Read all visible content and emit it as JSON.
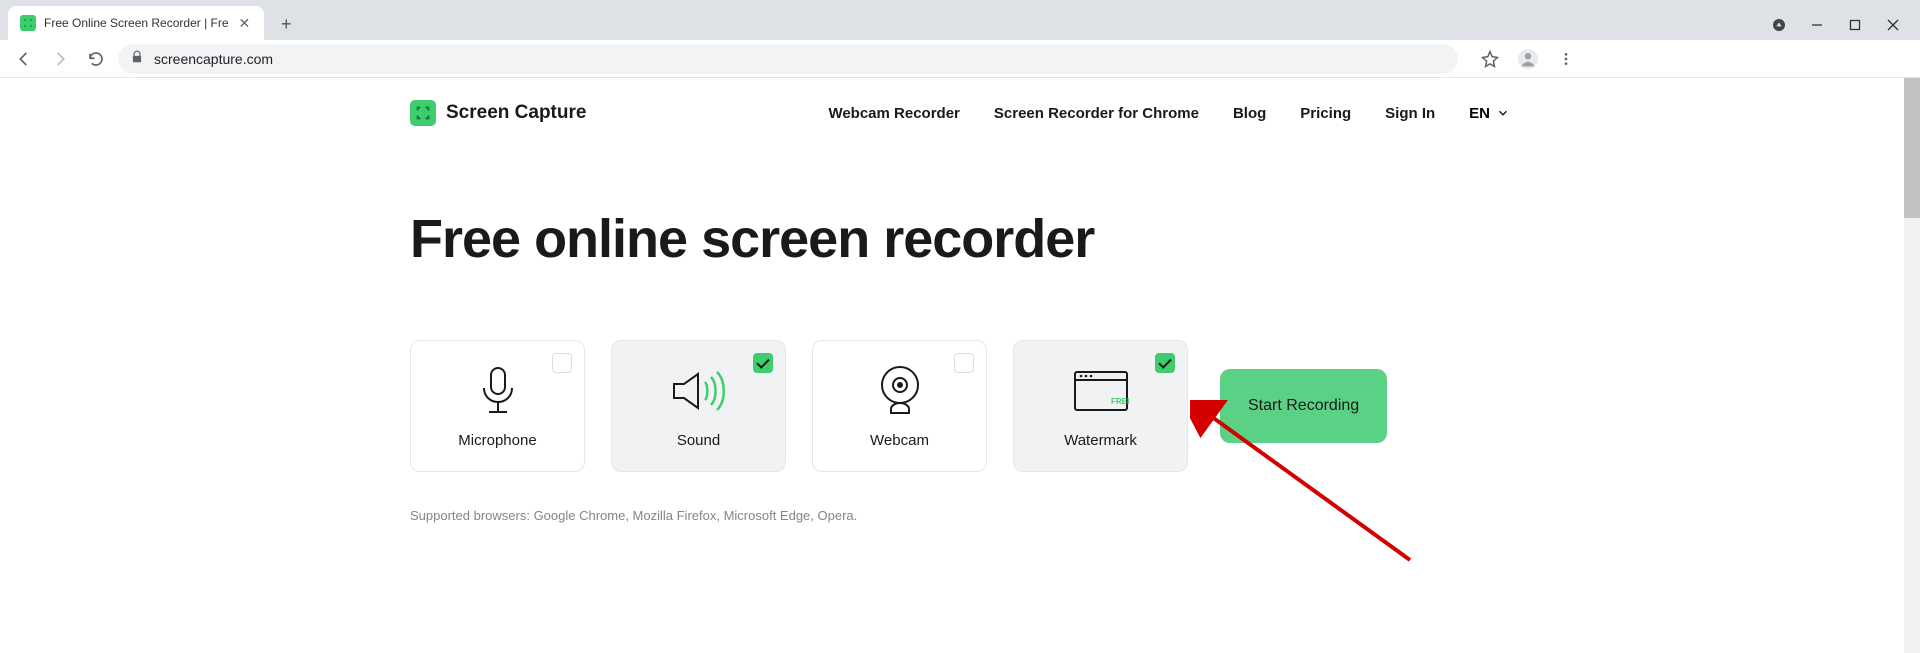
{
  "browser": {
    "tab_title": "Free Online Screen Recorder | Fre",
    "url": "screencapture.com"
  },
  "header": {
    "brand": "Screen Capture",
    "nav": {
      "webcam": "Webcam Recorder",
      "chrome": "Screen Recorder for Chrome",
      "blog": "Blog",
      "pricing": "Pricing",
      "signin": "Sign In",
      "lang": "EN"
    }
  },
  "hero": {
    "title": "Free online screen recorder"
  },
  "options": {
    "microphone": {
      "label": "Microphone",
      "checked": false
    },
    "sound": {
      "label": "Sound",
      "checked": true
    },
    "webcam": {
      "label": "Webcam",
      "checked": false
    },
    "watermark": {
      "label": "Watermark",
      "checked": true,
      "badge": "FREE"
    }
  },
  "cta": {
    "start": "Start Recording"
  },
  "footer_note": "Supported browsers: Google Chrome, Mozilla Firefox, Microsoft Edge, Opera."
}
